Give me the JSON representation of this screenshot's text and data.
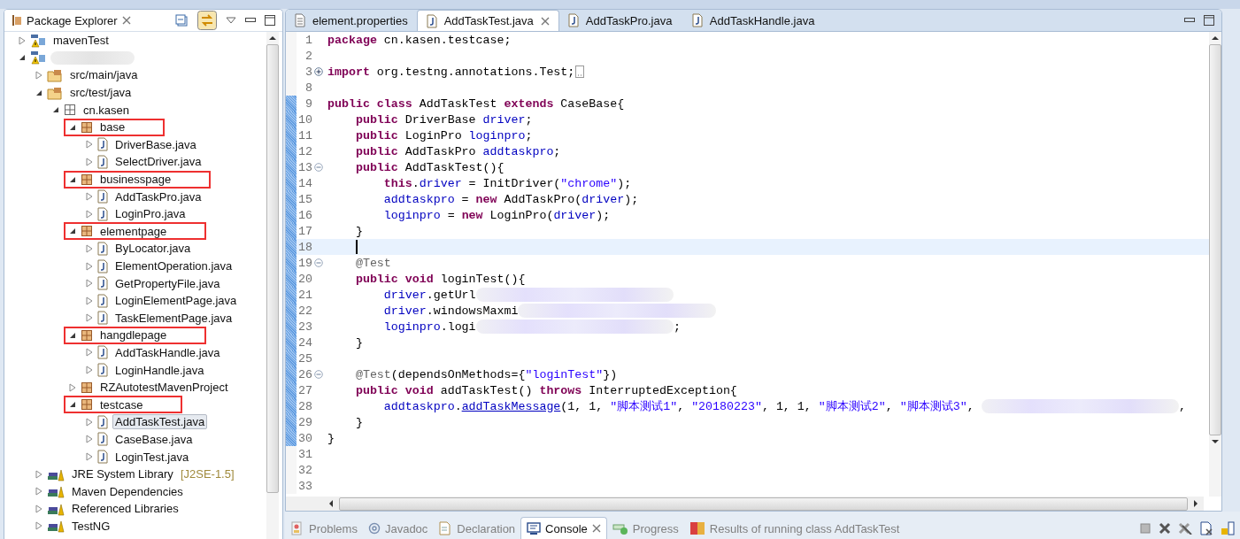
{
  "package_explorer": {
    "title": "Package Explorer",
    "tree": [
      {
        "kind": "project",
        "label": "mavenTest",
        "expanded": false,
        "selected": false,
        "boxed": false
      },
      {
        "kind": "project",
        "redacted": true,
        "expanded": true,
        "selected": false,
        "boxed": false,
        "children": [
          {
            "kind": "folder",
            "label": "src/main/java",
            "expanded": false,
            "selected": false,
            "boxed": false
          },
          {
            "kind": "folder",
            "label": "src/test/java",
            "expanded": true,
            "selected": false,
            "boxed": false,
            "children": [
              {
                "kind": "package-root",
                "label": "cn.kasen",
                "expanded": true,
                "selected": false,
                "boxed": false,
                "children": [
                  {
                    "kind": "package",
                    "label": "base",
                    "expanded": true,
                    "selected": false,
                    "boxed": true,
                    "children": [
                      {
                        "kind": "java",
                        "label": "DriverBase.java",
                        "expanded": false,
                        "selected": false,
                        "boxed": false
                      },
                      {
                        "kind": "java",
                        "label": "SelectDriver.java",
                        "expanded": false,
                        "selected": false,
                        "boxed": false
                      }
                    ]
                  },
                  {
                    "kind": "package",
                    "label": "businesspage",
                    "expanded": true,
                    "selected": false,
                    "boxed": true,
                    "children": [
                      {
                        "kind": "java",
                        "label": "AddTaskPro.java",
                        "expanded": false,
                        "selected": false,
                        "boxed": false
                      },
                      {
                        "kind": "java",
                        "label": "LoginPro.java",
                        "expanded": false,
                        "selected": false,
                        "boxed": false
                      }
                    ]
                  },
                  {
                    "kind": "package",
                    "label": "elementpage",
                    "expanded": true,
                    "selected": false,
                    "boxed": true,
                    "children": [
                      {
                        "kind": "java",
                        "label": "ByLocator.java",
                        "expanded": false,
                        "selected": false,
                        "boxed": false
                      },
                      {
                        "kind": "java",
                        "label": "ElementOperation.java",
                        "expanded": false,
                        "selected": false,
                        "boxed": false
                      },
                      {
                        "kind": "java",
                        "label": "GetPropertyFile.java",
                        "expanded": false,
                        "selected": false,
                        "boxed": false
                      },
                      {
                        "kind": "java",
                        "label": "LoginElementPage.java",
                        "expanded": false,
                        "selected": false,
                        "boxed": false
                      },
                      {
                        "kind": "java",
                        "label": "TaskElementPage.java",
                        "expanded": false,
                        "selected": false,
                        "boxed": false
                      }
                    ]
                  },
                  {
                    "kind": "package",
                    "label": "hangdlepage",
                    "expanded": true,
                    "selected": false,
                    "boxed": true,
                    "children": [
                      {
                        "kind": "java",
                        "label": "AddTaskHandle.java",
                        "expanded": false,
                        "selected": false,
                        "boxed": false
                      },
                      {
                        "kind": "java",
                        "label": "LoginHandle.java",
                        "expanded": false,
                        "selected": false,
                        "boxed": false
                      }
                    ]
                  },
                  {
                    "kind": "package",
                    "label": "RZAutotestMavenProject",
                    "expanded": false,
                    "selected": false,
                    "boxed": false
                  },
                  {
                    "kind": "package",
                    "label": "testcase",
                    "expanded": true,
                    "selected": false,
                    "boxed": true,
                    "children": [
                      {
                        "kind": "java",
                        "label": "AddTaskTest.java",
                        "expanded": false,
                        "selected": true,
                        "boxed": false
                      },
                      {
                        "kind": "java",
                        "label": "CaseBase.java",
                        "expanded": false,
                        "selected": false,
                        "boxed": false
                      },
                      {
                        "kind": "java",
                        "label": "LoginTest.java",
                        "expanded": false,
                        "selected": false,
                        "boxed": false
                      }
                    ]
                  }
                ]
              }
            ]
          },
          {
            "kind": "library",
            "label": "JRE System Library",
            "suffix": "[J2SE-1.5]",
            "expanded": false,
            "selected": false,
            "boxed": false
          },
          {
            "kind": "library",
            "label": "Maven Dependencies",
            "expanded": false,
            "selected": false,
            "boxed": false
          },
          {
            "kind": "library",
            "label": "Referenced Libraries",
            "expanded": false,
            "selected": false,
            "boxed": false
          },
          {
            "kind": "library",
            "label": "TestNG",
            "expanded": false,
            "selected": false,
            "boxed": false
          }
        ]
      }
    ]
  },
  "editor": {
    "tabs": [
      {
        "kind": "properties",
        "label": "element.properties",
        "selected": false
      },
      {
        "kind": "java",
        "label": "AddTaskTest.java",
        "selected": true
      },
      {
        "kind": "java",
        "label": "AddTaskPro.java",
        "selected": false
      },
      {
        "kind": "java",
        "label": "AddTaskHandle.java",
        "selected": false
      }
    ],
    "lines": [
      {
        "number": "1",
        "changed": false,
        "current": false,
        "tokens": [
          {
            "kind": "kw",
            "text": "package"
          },
          {
            "kind": "plain",
            "text": " cn.kasen.testcase;"
          }
        ]
      },
      {
        "number": "2",
        "changed": false,
        "current": false
      },
      {
        "number": "3",
        "foldable": true,
        "folded": true,
        "changed": false,
        "current": false,
        "tokens": [
          {
            "kind": "kw",
            "text": "import"
          },
          {
            "kind": "plain",
            "text": " org.testng.annotations.Test;"
          }
        ]
      },
      {
        "number": "8",
        "changed": false,
        "current": false
      },
      {
        "number": "9",
        "changed": true,
        "current": false,
        "tokens": [
          {
            "kind": "kw",
            "text": "public class"
          },
          {
            "kind": "plain",
            "text": " AddTaskTest "
          },
          {
            "kind": "kw",
            "text": "extends"
          },
          {
            "kind": "plain",
            "text": " CaseBase{"
          }
        ]
      },
      {
        "number": "10",
        "changed": true,
        "current": false,
        "tokens": [
          {
            "kind": "kw",
            "text": "    public"
          },
          {
            "kind": "plain",
            "text": " DriverBase "
          },
          {
            "kind": "field",
            "text": "driver"
          },
          {
            "kind": "plain",
            "text": ";"
          }
        ]
      },
      {
        "number": "11",
        "changed": true,
        "current": false,
        "tokens": [
          {
            "kind": "kw",
            "text": "    public"
          },
          {
            "kind": "plain",
            "text": " LoginPro "
          },
          {
            "kind": "field",
            "text": "loginpro"
          },
          {
            "kind": "plain",
            "text": ";"
          }
        ]
      },
      {
        "number": "12",
        "changed": true,
        "current": false,
        "tokens": [
          {
            "kind": "kw",
            "text": "    public"
          },
          {
            "kind": "plain",
            "text": " AddTaskPro "
          },
          {
            "kind": "field",
            "text": "addtaskpro"
          },
          {
            "kind": "plain",
            "text": ";"
          }
        ]
      },
      {
        "number": "13",
        "foldable": true,
        "folded": false,
        "changed": true,
        "current": false,
        "tokens": [
          {
            "kind": "kw",
            "text": "    public"
          },
          {
            "kind": "plain",
            "text": " AddTaskTest(){"
          }
        ]
      },
      {
        "number": "14",
        "changed": true,
        "current": false,
        "tokens": [
          {
            "kind": "kw",
            "text": "        this"
          },
          {
            "kind": "plain",
            "text": "."
          },
          {
            "kind": "field",
            "text": "driver"
          },
          {
            "kind": "plain",
            "text": " = InitDriver("
          },
          {
            "kind": "str",
            "text": "\"chrome\""
          },
          {
            "kind": "plain",
            "text": ");"
          }
        ]
      },
      {
        "number": "15",
        "changed": true,
        "current": false,
        "tokens": [
          {
            "kind": "field",
            "text": "        addtaskpro"
          },
          {
            "kind": "plain",
            "text": " = "
          },
          {
            "kind": "kw",
            "text": "new"
          },
          {
            "kind": "plain",
            "text": " AddTaskPro("
          },
          {
            "kind": "field",
            "text": "driver"
          },
          {
            "kind": "plain",
            "text": ");"
          }
        ]
      },
      {
        "number": "16",
        "changed": true,
        "current": false,
        "tokens": [
          {
            "kind": "field",
            "text": "        loginpro"
          },
          {
            "kind": "plain",
            "text": " = "
          },
          {
            "kind": "kw",
            "text": "new"
          },
          {
            "kind": "plain",
            "text": " LoginPro("
          },
          {
            "kind": "field",
            "text": "driver"
          },
          {
            "kind": "plain",
            "text": ");"
          }
        ]
      },
      {
        "number": "17",
        "changed": true,
        "current": false,
        "tokens": [
          {
            "kind": "plain",
            "text": "    }"
          }
        ]
      },
      {
        "number": "18",
        "changed": true,
        "current": true
      },
      {
        "number": "19",
        "foldable": true,
        "folded": false,
        "changed": true,
        "current": false,
        "tokens": [
          {
            "kind": "ann",
            "text": "    @Test"
          }
        ]
      },
      {
        "number": "20",
        "changed": true,
        "current": false,
        "tokens": [
          {
            "kind": "kw",
            "text": "    public void"
          },
          {
            "kind": "plain",
            "text": " loginTest(){"
          }
        ]
      },
      {
        "number": "21",
        "changed": true,
        "current": false,
        "tokens": [
          {
            "kind": "field",
            "text": "        driver"
          },
          {
            "kind": "plain",
            "text": ".getUrl"
          },
          {
            "kind": "redacted"
          }
        ]
      },
      {
        "number": "22",
        "changed": true,
        "current": false,
        "tokens": [
          {
            "kind": "field",
            "text": "        driver"
          },
          {
            "kind": "plain",
            "text": ".windowsMaxmi"
          },
          {
            "kind": "redacted"
          }
        ]
      },
      {
        "number": "23",
        "changed": true,
        "current": false,
        "tokens": [
          {
            "kind": "field",
            "text": "        loginpro"
          },
          {
            "kind": "plain",
            "text": ".logi"
          },
          {
            "kind": "redacted"
          },
          {
            "kind": "plain",
            "text": ";"
          }
        ]
      },
      {
        "number": "24",
        "changed": true,
        "current": false,
        "tokens": [
          {
            "kind": "plain",
            "text": "    }"
          }
        ]
      },
      {
        "number": "25",
        "changed": true,
        "current": false
      },
      {
        "number": "26",
        "foldable": true,
        "folded": false,
        "changed": true,
        "current": false,
        "tokens": [
          {
            "kind": "ann",
            "text": "    @Test"
          },
          {
            "kind": "plain",
            "text": "(dependsOnMethods={"
          },
          {
            "kind": "str",
            "text": "\"loginTest\""
          },
          {
            "kind": "plain",
            "text": "})"
          }
        ]
      },
      {
        "number": "27",
        "changed": true,
        "current": false,
        "tokens": [
          {
            "kind": "kw",
            "text": "    public void"
          },
          {
            "kind": "plain",
            "text": " addTaskTest() "
          },
          {
            "kind": "kw",
            "text": "throws"
          },
          {
            "kind": "plain",
            "text": " InterruptedException{"
          }
        ]
      },
      {
        "number": "28",
        "changed": true,
        "current": false,
        "tokens": [
          {
            "kind": "field",
            "text": "        addtaskpro"
          },
          {
            "kind": "plain",
            "text": "."
          },
          {
            "kind": "link",
            "text": "addTaskMessage"
          },
          {
            "kind": "plain",
            "text": "(1, 1, "
          },
          {
            "kind": "str",
            "text": "\"脚本测试1\""
          },
          {
            "kind": "plain",
            "text": ", "
          },
          {
            "kind": "str",
            "text": "\"20180223\""
          },
          {
            "kind": "plain",
            "text": ", 1, 1, "
          },
          {
            "kind": "str",
            "text": "\"脚本测试2\""
          },
          {
            "kind": "plain",
            "text": ", "
          },
          {
            "kind": "str",
            "text": "\"脚本测试3\""
          },
          {
            "kind": "plain",
            "text": ", "
          },
          {
            "kind": "redacted"
          },
          {
            "kind": "plain",
            "text": ","
          }
        ]
      },
      {
        "number": "29",
        "changed": true,
        "current": false,
        "tokens": [
          {
            "kind": "plain",
            "text": "    }"
          }
        ]
      },
      {
        "number": "30",
        "changed": true,
        "current": false,
        "tokens": [
          {
            "kind": "plain",
            "text": "}"
          }
        ]
      },
      {
        "number": "31",
        "changed": false,
        "current": false
      },
      {
        "number": "32",
        "changed": false,
        "current": false
      },
      {
        "number": "33",
        "changed": false,
        "current": false
      }
    ]
  },
  "bottom_tabs": [
    {
      "kind": "problems",
      "label": "Problems",
      "selected": false
    },
    {
      "kind": "javadoc",
      "label": "Javadoc",
      "selected": false
    },
    {
      "kind": "declaration",
      "label": "Declaration",
      "selected": false
    },
    {
      "kind": "console",
      "label": "Console",
      "selected": true
    },
    {
      "kind": "progress",
      "label": "Progress",
      "selected": false
    },
    {
      "kind": "results",
      "label": "Results of running class AddTaskTest",
      "selected": false
    }
  ]
}
